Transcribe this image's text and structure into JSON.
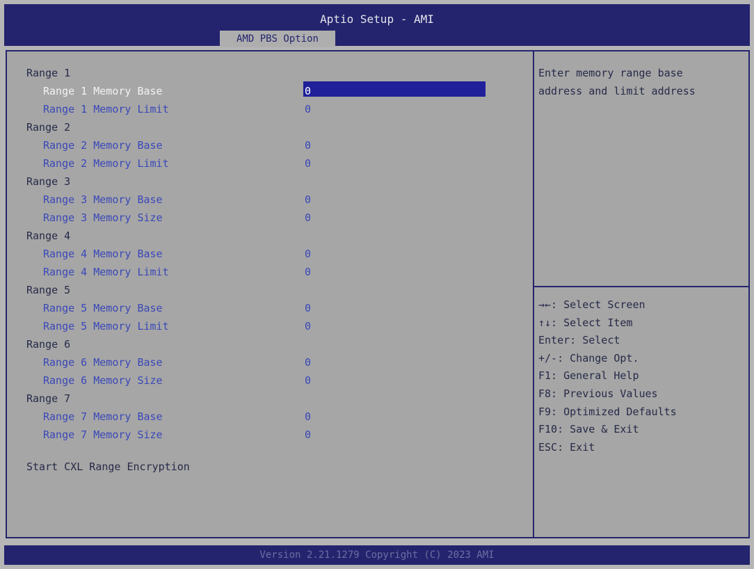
{
  "header": {
    "title": "Aptio Setup - AMI",
    "tab": "AMD PBS Option"
  },
  "main": {
    "groups": [
      {
        "label": "Range 1",
        "items": [
          {
            "label": "Range 1 Memory Base",
            "value": "0",
            "selected": true
          },
          {
            "label": "Range 1 Memory Limit",
            "value": "0"
          }
        ]
      },
      {
        "label": "Range 2",
        "items": [
          {
            "label": "Range 2 Memory Base",
            "value": "0"
          },
          {
            "label": "Range 2 Memory Limit",
            "value": "0"
          }
        ]
      },
      {
        "label": "Range 3",
        "items": [
          {
            "label": "Range 3 Memory Base",
            "value": "0"
          },
          {
            "label": "Range 3 Memory Size",
            "value": "0"
          }
        ]
      },
      {
        "label": "Range 4",
        "items": [
          {
            "label": "Range 4 Memory Base",
            "value": "0"
          },
          {
            "label": "Range 4 Memory Limit",
            "value": "0"
          }
        ]
      },
      {
        "label": "Range 5",
        "items": [
          {
            "label": "Range 5 Memory Base",
            "value": "0"
          },
          {
            "label": "Range 5 Memory Limit",
            "value": "0"
          }
        ]
      },
      {
        "label": "Range 6",
        "items": [
          {
            "label": "Range 6 Memory Base",
            "value": "0"
          },
          {
            "label": "Range 6 Memory Size",
            "value": "0"
          }
        ]
      },
      {
        "label": "Range 7",
        "items": [
          {
            "label": "Range 7 Memory Base",
            "value": "0"
          },
          {
            "label": "Range 7 Memory Size",
            "value": "0"
          }
        ]
      }
    ],
    "action": "Start CXL Range Encryption"
  },
  "help": {
    "line1": "Enter memory range base",
    "line2": "address and limit address"
  },
  "keys": [
    "→←: Select Screen",
    "↑↓: Select Item",
    "Enter: Select",
    "+/-: Change Opt.",
    "F1: General Help",
    "F8: Previous Values",
    "F9: Optimized Defaults",
    "F10: Save & Exit",
    "ESC: Exit"
  ],
  "footer": {
    "text": "Version 2.21.1279 Copyright (C) 2023 AMI"
  },
  "colors": {
    "title_bar": "#24246e",
    "panel_bg": "#a6a6a6",
    "item_text": "#3a48b8",
    "selection": "#20209a"
  }
}
